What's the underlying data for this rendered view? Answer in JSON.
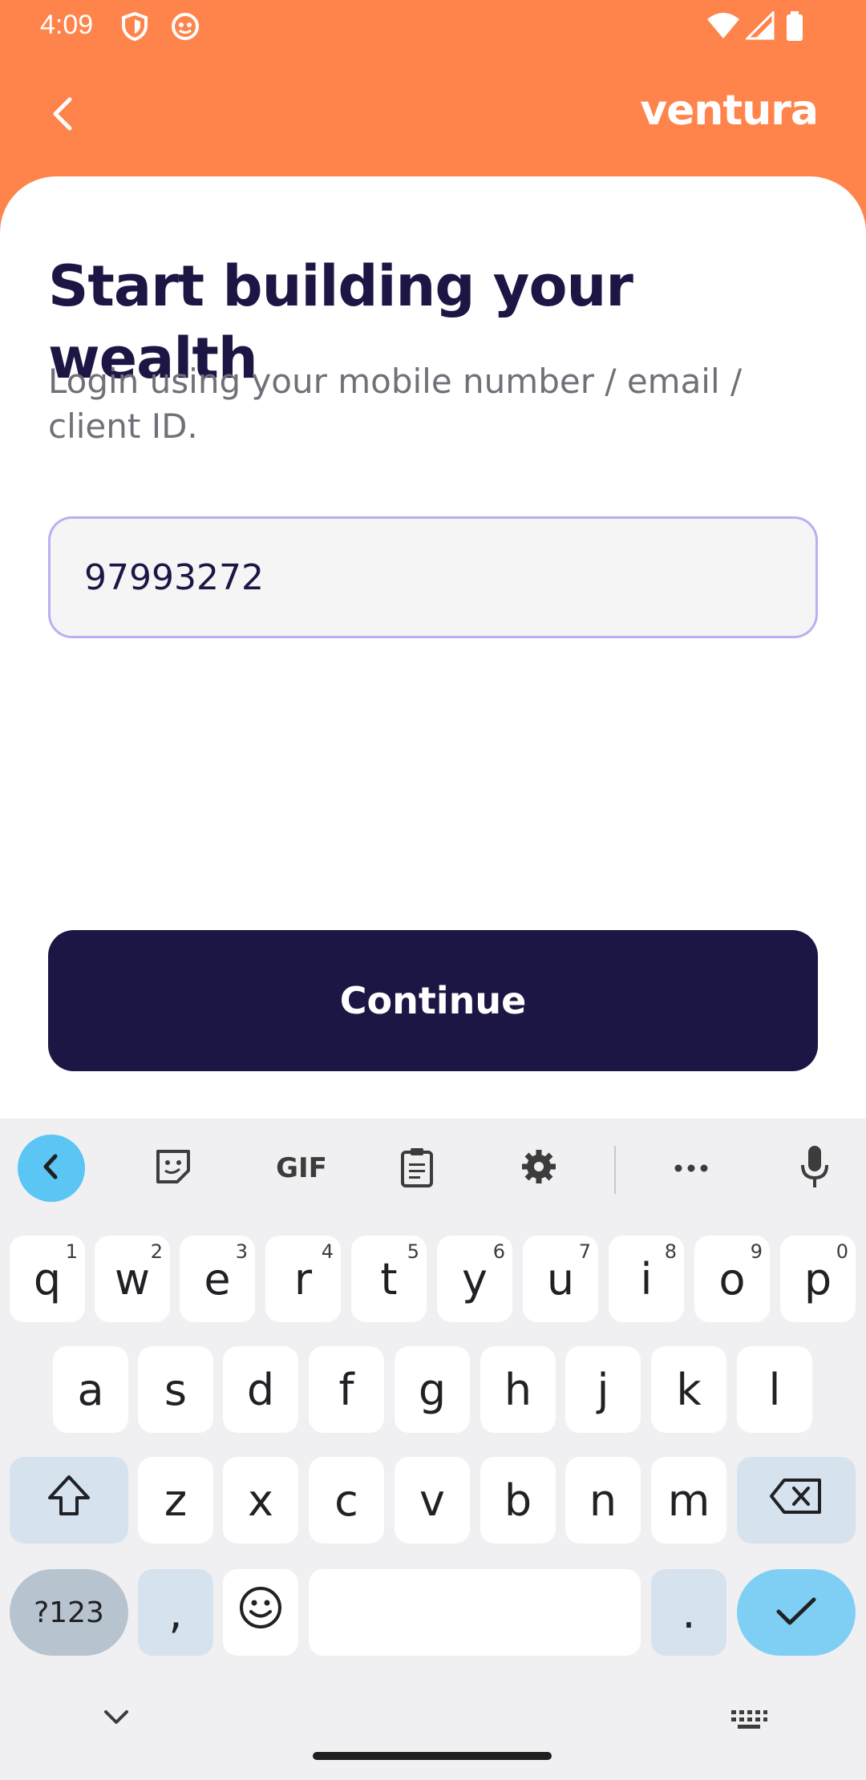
{
  "status_bar": {
    "time": "4:09"
  },
  "header": {
    "brand": "ventura"
  },
  "login": {
    "headline": "Start building your wealth",
    "subtext": "Login using your mobile number / email / client ID.",
    "input_value": "97993272",
    "continue_label": "Continue"
  },
  "keyboard": {
    "toolbar": {
      "gif_label": "GIF"
    },
    "row1": [
      {
        "key": "q",
        "hint": "1"
      },
      {
        "key": "w",
        "hint": "2"
      },
      {
        "key": "e",
        "hint": "3"
      },
      {
        "key": "r",
        "hint": "4"
      },
      {
        "key": "t",
        "hint": "5"
      },
      {
        "key": "y",
        "hint": "6"
      },
      {
        "key": "u",
        "hint": "7"
      },
      {
        "key": "i",
        "hint": "8"
      },
      {
        "key": "o",
        "hint": "9"
      },
      {
        "key": "p",
        "hint": "0"
      }
    ],
    "row2": [
      "a",
      "s",
      "d",
      "f",
      "g",
      "h",
      "j",
      "k",
      "l"
    ],
    "row3": [
      "z",
      "x",
      "c",
      "v",
      "b",
      "n",
      "m"
    ],
    "row4": {
      "symbols": "?123",
      "comma": ",",
      "period": "."
    }
  },
  "colors": {
    "header_bg": "#FF844B",
    "primary": "#1C1645",
    "field_border": "#B9B0F2",
    "accent": "#7FCFF5"
  }
}
